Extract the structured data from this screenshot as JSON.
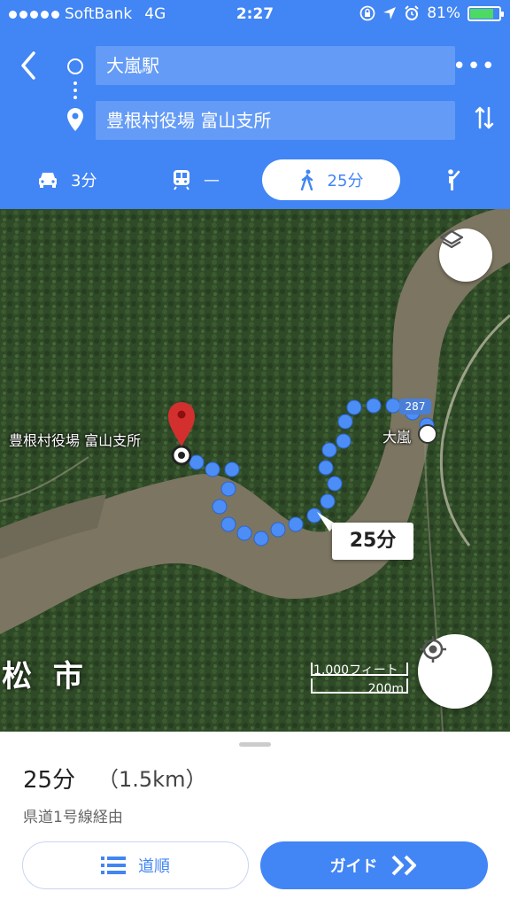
{
  "status_bar": {
    "carrier": "SoftBank",
    "network": "4G",
    "time": "2:27",
    "battery": "81%",
    "battery_level": 0.81
  },
  "search": {
    "origin": "大嵐駅",
    "destination": "豊根村役場 富山支所"
  },
  "modes": {
    "car": "3分",
    "transit": "—",
    "walk": "25分"
  },
  "map": {
    "destination_label": "豊根村役場 富山支所",
    "origin_label": "大嵐",
    "route_number": "287",
    "callout_time": "25分",
    "scale_top": "1,000フィート",
    "scale_bottom": "200m",
    "city_text": "松 市"
  },
  "sheet": {
    "duration": "25分",
    "distance": "（1.5km）",
    "via": "県道1号線経由",
    "steps_label": "道順",
    "guide_label": "ガイド"
  },
  "colors": {
    "brand_blue": "#4285f4",
    "route_dot": "#4d8ef6",
    "pin_red": "#d32f2f"
  }
}
